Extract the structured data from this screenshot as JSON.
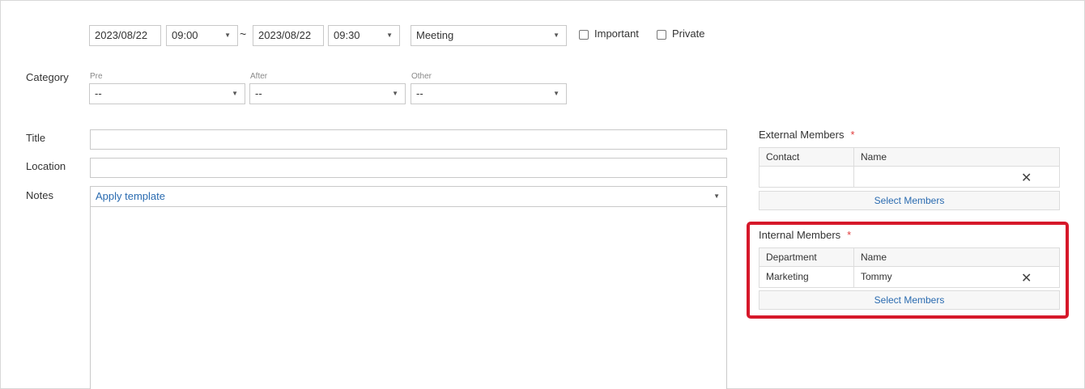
{
  "schedule": {
    "start_date": "2023/08/22",
    "start_time": "09:00",
    "separator": "~",
    "end_date": "2023/08/22",
    "end_time": "09:30",
    "type": "Meeting",
    "important_label": "Important",
    "private_label": "Private"
  },
  "category": {
    "label": "Category",
    "pre_label": "Pre",
    "pre_value": "--",
    "after_label": "After",
    "after_value": "--",
    "other_label": "Other",
    "other_value": "--"
  },
  "form": {
    "title_label": "Title",
    "title_value": "",
    "location_label": "Location",
    "location_value": "",
    "notes_label": "Notes",
    "apply_template": "Apply template",
    "notes_value": ""
  },
  "external_members": {
    "title": "External Members",
    "required_mark": "*",
    "col1": "Contact",
    "col2": "Name",
    "rows": [
      {
        "contact": "",
        "name": ""
      }
    ],
    "select_button": "Select Members"
  },
  "internal_members": {
    "title": "Internal Members",
    "required_mark": "*",
    "col1": "Department",
    "col2": "Name",
    "rows": [
      {
        "department": "Marketing",
        "name": "Tommy"
      }
    ],
    "select_button": "Select Members"
  },
  "icons": {
    "dropdown": "chevron-down-icon",
    "remove": "close-icon"
  },
  "colors": {
    "link": "#2a6bb0",
    "required": "#e03c3c",
    "highlight": "#d6182a"
  }
}
